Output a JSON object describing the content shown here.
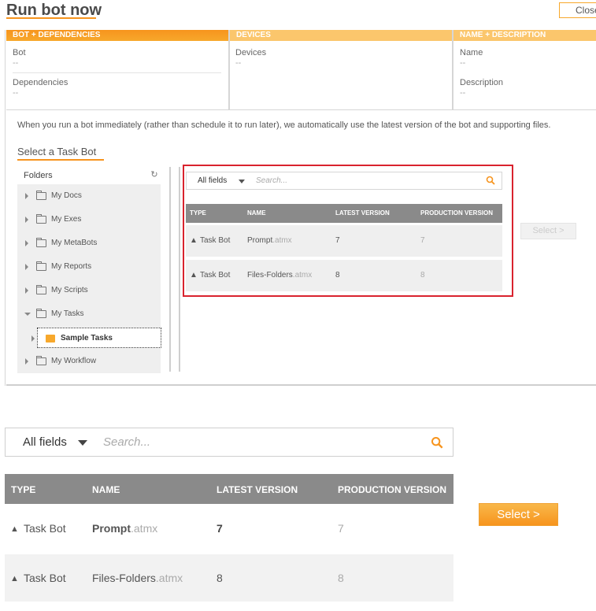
{
  "header": {
    "title": "Run bot now",
    "close_label": "Close"
  },
  "panels": {
    "bot_deps": {
      "heading": "BOT + DEPENDENCIES",
      "bot_label": "Bot",
      "bot_value": "--",
      "deps_label": "Dependencies",
      "deps_value": "--"
    },
    "devices": {
      "heading": "DEVICES",
      "devices_label": "Devices",
      "devices_value": "--"
    },
    "name_desc": {
      "heading": "NAME + DESCRIPTION",
      "name_label": "Name",
      "name_value": "--",
      "desc_label": "Description",
      "desc_value": "--"
    }
  },
  "info_text": "When you run a bot immediately (rather than schedule it to run later), we automatically use the latest version of the bot and supporting files.",
  "section_title": "Select a Task Bot",
  "folders": {
    "header": "Folders",
    "items": [
      {
        "label": "My Docs",
        "expanded": false
      },
      {
        "label": "My Exes",
        "expanded": false
      },
      {
        "label": "My MetaBots",
        "expanded": false
      },
      {
        "label": "My Reports",
        "expanded": false
      },
      {
        "label": "My Scripts",
        "expanded": false
      },
      {
        "label": "My Tasks",
        "expanded": true
      },
      {
        "label": "Sample Tasks",
        "selected": true
      },
      {
        "label": "My Workflow",
        "expanded": false
      }
    ]
  },
  "search": {
    "field_selector": "All fields",
    "placeholder_small": "Search...",
    "placeholder_large": "Search..."
  },
  "table": {
    "columns": [
      "TYPE",
      "NAME",
      "LATEST VERSION",
      "PRODUCTION VERSION"
    ],
    "rows": [
      {
        "type": "Task Bot",
        "name": "Prompt",
        "ext": ".atmx",
        "latest": "7",
        "production": "7"
      },
      {
        "type": "Task Bot",
        "name": "Files-Folders",
        "ext": ".atmx",
        "latest": "8",
        "production": "8"
      }
    ]
  },
  "select_label": "Select >",
  "colors": {
    "accent": "#f7941d",
    "highlight": "#d9232e"
  }
}
